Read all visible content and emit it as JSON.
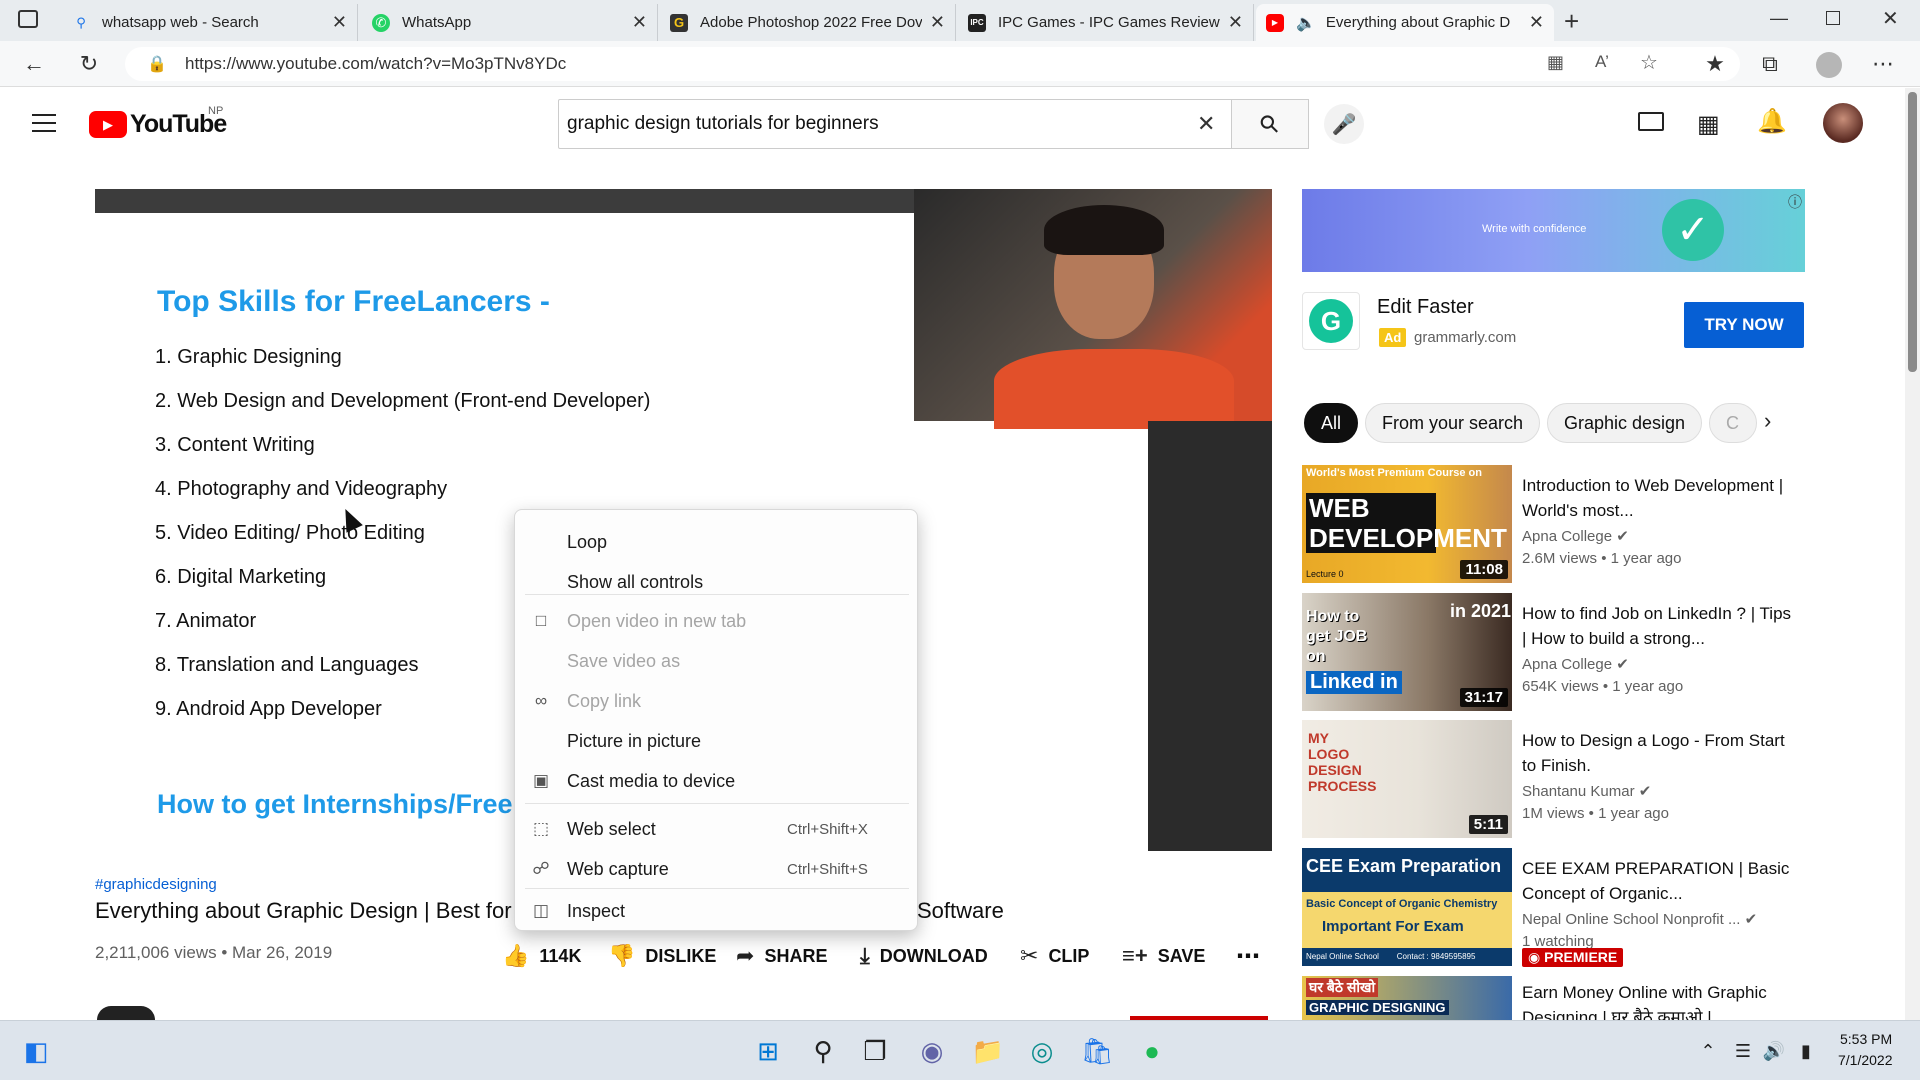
{
  "browser": {
    "tabs": [
      {
        "label": "whatsapp web - Search",
        "icon": "search-icon"
      },
      {
        "label": "WhatsApp",
        "icon": "whatsapp-icon"
      },
      {
        "label": "Adobe Photoshop 2022 Free Dov",
        "icon": "g-favicon"
      },
      {
        "label": "IPC Games - IPC Games Reviews",
        "icon": "ipc-favicon"
      },
      {
        "label": "Everything about Graphic D",
        "icon": "youtube-icon"
      }
    ],
    "url": "https://www.youtube.com/watch?v=Mo3pTNv8YDc"
  },
  "youtube": {
    "logo_text": "YouTube",
    "region": "NP",
    "search_value": "graphic design tutorials for beginners"
  },
  "video": {
    "slide_heading": "Top Skills for FreeLancers -",
    "skills": [
      "1.  Graphic Designing",
      "2.  Web Design and Development (Front-end Developer)",
      "3.  Content Writing",
      "4.  Photography and Videography",
      "5.  Video Editing/ Photo Editing",
      "6.  Digital Marketing",
      "7.  Animator",
      "8.  Translation and Languages",
      "9.   Android App Developer"
    ],
    "slide_heading2": "How to get Internships/Free",
    "hashtag": "#graphicdesigning",
    "title_left": "Everything about Graphic Design | Best for",
    "title_right": "Software",
    "stats": "2,211,006 views • Mar 26, 2019",
    "likes": "114K",
    "dislike": "DISLIKE",
    "share": "SHARE",
    "download": "DOWNLOAD",
    "clip": "CLIP",
    "save": "SAVE"
  },
  "context_menu": {
    "items": [
      {
        "label": "Loop",
        "icon": "",
        "shortcut": "",
        "disabled": false
      },
      {
        "label": "Show all controls",
        "icon": "",
        "shortcut": "",
        "disabled": false
      },
      {
        "label": "Open video in new tab",
        "icon": "new-tab-icon",
        "shortcut": "",
        "disabled": true
      },
      {
        "label": "Save video as",
        "icon": "",
        "shortcut": "",
        "disabled": true
      },
      {
        "label": "Copy link",
        "icon": "link-icon",
        "shortcut": "",
        "disabled": true
      },
      {
        "label": "Picture in picture",
        "icon": "",
        "shortcut": "",
        "disabled": false
      },
      {
        "label": "Cast media to device",
        "icon": "cast-icon",
        "shortcut": "",
        "disabled": false
      },
      {
        "label": "Web select",
        "icon": "web-select-icon",
        "shortcut": "Ctrl+Shift+X",
        "disabled": false
      },
      {
        "label": "Web capture",
        "icon": "web-capture-icon",
        "shortcut": "Ctrl+Shift+S",
        "disabled": false
      },
      {
        "label": "Inspect",
        "icon": "inspect-icon",
        "shortcut": "",
        "disabled": false
      }
    ]
  },
  "ad": {
    "banner_text": "Write with confidence",
    "title": "Edit Faster",
    "badge": "Ad",
    "domain": "grammarly.com",
    "cta": "TRY NOW"
  },
  "chips": [
    "All",
    "From your search",
    "Graphic design",
    "C"
  ],
  "related": [
    {
      "title": "Introduction to Web Development | World's most...",
      "channel": "Apna College",
      "meta": "2.6M views • 1 year ago",
      "duration": "11:08",
      "thumb_text": "WEB DEVELOPMENT",
      "thumb_top": "World's Most Premium Course on",
      "thumb_bottom": "Lecture 0"
    },
    {
      "title": "How to find Job on LinkedIn ? | Tips | How to build a strong...",
      "channel": "Apna College",
      "meta": "654K views • 1 year ago",
      "duration": "31:17",
      "thumb_text": "How to get JOB on",
      "thumb_top": "in 2021",
      "thumb_bottom": "Linked in"
    },
    {
      "title": "How to Design a Logo - From Start to Finish.",
      "channel": "Shantanu Kumar",
      "meta": "1M views • 1 year ago",
      "duration": "5:11",
      "thumb_text": "MY LOGO DESIGN PROCESS",
      "thumb_top": "",
      "thumb_bottom": ""
    },
    {
      "title": "CEE EXAM PREPARATION | Basic Concept of Organic...",
      "channel": "Nepal Online School Nonprofit ...",
      "meta": "1 watching",
      "duration": "",
      "badge": "PREMIERE",
      "thumb_text": "CEE Exam Preparation",
      "thumb_top": "Basic Concept of Organic Chemistry",
      "thumb_bottom": "Important For Exam",
      "thumb_footer": "Nepal Online School        Contact : 9849595895"
    },
    {
      "title": "Earn Money Online with Graphic Designing | घर बैठे कमाओ |",
      "channel": "",
      "meta": "",
      "duration": "",
      "thumb_text": "घर बैठे सीखो",
      "thumb_top": "",
      "thumb_bottom": "GRAPHIC DESIGNING"
    }
  ],
  "taskbar": {
    "time": "5:53 PM",
    "date": "7/1/2022"
  },
  "colors": {
    "youtube_red": "#ff0000",
    "accent_blue": "#1a73e8",
    "ad_yellow": "#f5c518",
    "try_now": "#065fd4"
  }
}
